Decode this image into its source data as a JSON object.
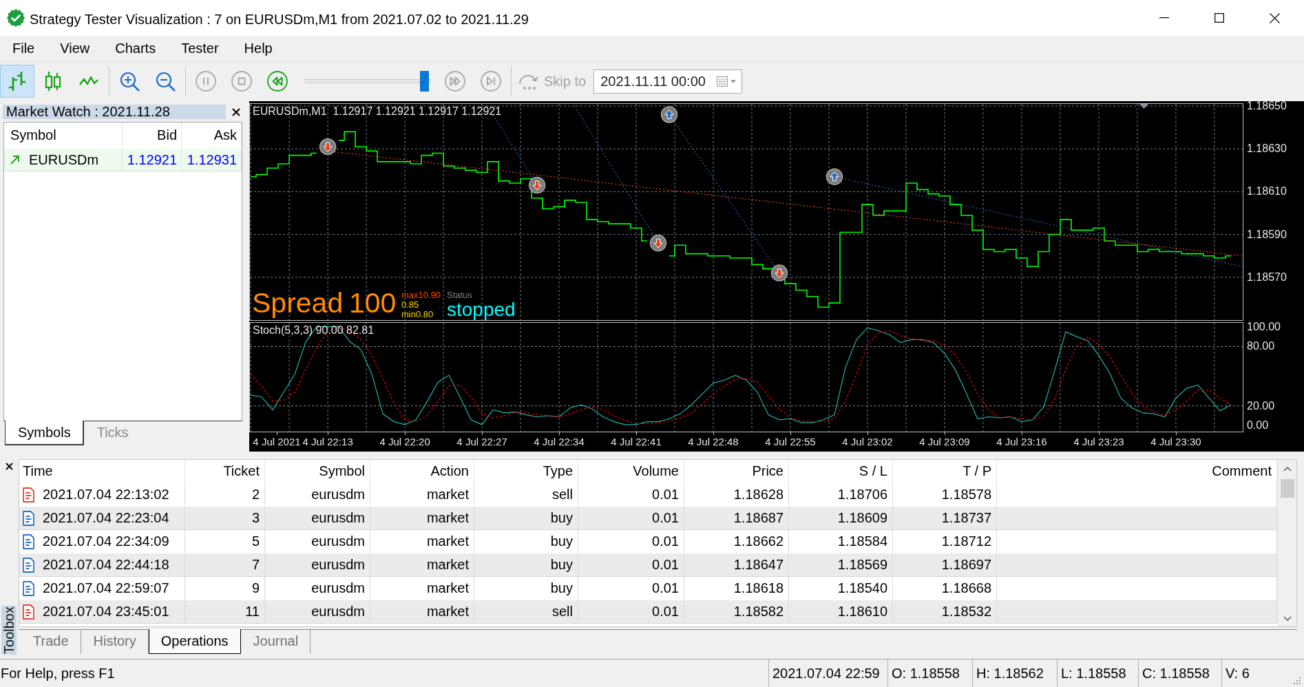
{
  "window": {
    "title": "Strategy Tester Visualization : 7 on EURUSDm,M1 from 2021.07.02 to 2021.11.29"
  },
  "menu": [
    "File",
    "View",
    "Charts",
    "Tester",
    "Help"
  ],
  "toolbar": {
    "chart_modes": [
      {
        "kind": "bars",
        "selected": true
      },
      {
        "kind": "candles",
        "selected": false
      },
      {
        "kind": "line",
        "selected": false
      }
    ],
    "playback": [
      {
        "kind": "pause",
        "disabled": true
      },
      {
        "kind": "stop",
        "disabled": true
      },
      {
        "kind": "rewind",
        "disabled": false
      }
    ],
    "speed_slider": {
      "level": 0.98
    },
    "stepping": [
      {
        "kind": "fast-forward",
        "disabled": true
      },
      {
        "kind": "step-end",
        "disabled": true
      }
    ],
    "skip_to": {
      "label": "Skip to",
      "disabled": true,
      "value": "2021.11.11 00:00"
    }
  },
  "market_watch": {
    "title": "Market Watch : 2021.11.28",
    "columns": [
      "Symbol",
      "Bid",
      "Ask"
    ],
    "rows": [
      {
        "rising": true,
        "symbol": "EURUSDm",
        "bid": "1.12921",
        "ask": "1.12931"
      }
    ],
    "tabs": [
      {
        "label": "Symbols",
        "selected": true
      },
      {
        "label": "Ticks",
        "selected": false
      }
    ]
  },
  "chart": {
    "chart_data": [
      {
        "type": "step",
        "title": "EURUSDm,M1  1.12917 1.12921 1.12917 1.12921",
        "tick_labels": "y",
        "grid": true,
        "xlim": [
          "2021-07-04T22:05:52",
          "2021-07-04T23:41:38"
        ],
        "ylim": [
          1.1855,
          1.18651
        ],
        "yticks": [
          {
            "value": 1.1865,
            "label": "1.18650"
          },
          {
            "value": 1.1863,
            "label": "1.18630"
          },
          {
            "value": 1.1861,
            "label": "1.18610"
          },
          {
            "value": 1.1859,
            "label": "1.18590"
          },
          {
            "value": 1.1857,
            "label": "1.18570"
          }
        ],
        "xticks": [
          "2021-07-04T22:08:22",
          "2021-07-04T22:13",
          "2021-07-04T22:20",
          "2021-07-04T22:27",
          "2021-07-04T22:34",
          "2021-07-04T22:41",
          "2021-07-04T22:48",
          "2021-07-04T22:55",
          "2021-07-04T23:02",
          "2021-07-04T23:09",
          "2021-07-04T23:16",
          "2021-07-04T23:23",
          "2021-07-04T23:30"
        ],
        "x": [
          "2021-07-04T22:06",
          "2021-07-04T22:07",
          "2021-07-04T22:08",
          "2021-07-04T22:09",
          "2021-07-04T22:10",
          "2021-07-04T22:11",
          "2021-07-04T22:12",
          "2021-07-04T22:13",
          "2021-07-04T22:14",
          "2021-07-04T22:15",
          "2021-07-04T22:16",
          "2021-07-04T22:17",
          "2021-07-04T22:18",
          "2021-07-04T22:19",
          "2021-07-04T22:20",
          "2021-07-04T22:21",
          "2021-07-04T22:22",
          "2021-07-04T22:23",
          "2021-07-04T22:24",
          "2021-07-04T22:25",
          "2021-07-04T22:26",
          "2021-07-04T22:27",
          "2021-07-04T22:28",
          "2021-07-04T22:29",
          "2021-07-04T22:30",
          "2021-07-04T22:31",
          "2021-07-04T22:32",
          "2021-07-04T22:33",
          "2021-07-04T22:34",
          "2021-07-04T22:35",
          "2021-07-04T22:36",
          "2021-07-04T22:37",
          "2021-07-04T22:38",
          "2021-07-04T22:39",
          "2021-07-04T22:40",
          "2021-07-04T22:41",
          "2021-07-04T22:42",
          "2021-07-04T22:43",
          "2021-07-04T22:44",
          "2021-07-04T22:45",
          "2021-07-04T22:46",
          "2021-07-04T22:47",
          "2021-07-04T22:48",
          "2021-07-04T22:49",
          "2021-07-04T22:50",
          "2021-07-04T22:51",
          "2021-07-04T22:52",
          "2021-07-04T22:53",
          "2021-07-04T22:54",
          "2021-07-04T22:55",
          "2021-07-04T22:56",
          "2021-07-04T22:57",
          "2021-07-04T22:58",
          "2021-07-04T22:59",
          "2021-07-04T23:00",
          "2021-07-04T23:01",
          "2021-07-04T23:02",
          "2021-07-04T23:03",
          "2021-07-04T23:04",
          "2021-07-04T23:05",
          "2021-07-04T23:06",
          "2021-07-04T23:07",
          "2021-07-04T23:08",
          "2021-07-04T23:09",
          "2021-07-04T23:10",
          "2021-07-04T23:11",
          "2021-07-04T23:12",
          "2021-07-04T23:13",
          "2021-07-04T23:14",
          "2021-07-04T23:15",
          "2021-07-04T23:16",
          "2021-07-04T23:17",
          "2021-07-04T23:18",
          "2021-07-04T23:19",
          "2021-07-04T23:20",
          "2021-07-04T23:21",
          "2021-07-04T23:22",
          "2021-07-04T23:23",
          "2021-07-04T23:24",
          "2021-07-04T23:25",
          "2021-07-04T23:26",
          "2021-07-04T23:27",
          "2021-07-04T23:28",
          "2021-07-04T23:29",
          "2021-07-04T23:30",
          "2021-07-04T23:31",
          "2021-07-04T23:32",
          "2021-07-04T23:33",
          "2021-07-04T23:34",
          "2021-07-04T23:35"
        ],
        "series": [
          {
            "color": "#00ff00",
            "values": [
              1.18617,
              1.18618,
              1.18621,
              1.18623,
              1.18627,
              1.18627,
              1.18628,
              null,
              1.18634,
              1.18638,
              1.18631,
              1.18629,
              1.18624,
              1.18624,
              1.18624,
              1.18623,
              1.18627,
              1.18628,
              1.18622,
              1.18621,
              1.1862,
              1.18619,
              1.18624,
              1.18615,
              1.18614,
              1.18616,
              1.18607,
              1.18602,
              1.18603,
              1.18606,
              1.18605,
              1.18597,
              1.18596,
              1.18595,
              1.18595,
              1.18593,
              1.18587,
              null,
              1.1858,
              1.18585,
              1.18581,
              1.18581,
              1.1858,
              1.1858,
              1.18579,
              1.18579,
              1.18576,
              1.18574,
              1.18572,
              1.18567,
              1.18564,
              1.18561,
              1.18556,
              1.18558,
              1.18591,
              1.18591,
              1.18604,
              1.18599,
              1.18601,
              1.18601,
              1.18614,
              1.18611,
              1.18609,
              1.18608,
              1.18604,
              1.18599,
              1.18592,
              1.18583,
              1.18582,
              1.18583,
              1.18579,
              1.18575,
              1.18582,
              1.1859,
              1.18597,
              1.18592,
              1.18592,
              1.18593,
              1.18587,
              1.18585,
              1.18585,
              1.18582,
              1.18583,
              1.18582,
              1.18582,
              1.18581,
              1.18581,
              1.1858,
              1.18579,
              1.1858
            ]
          },
          {
            "type": "line",
            "line_style": "dotted",
            "color": "#e8432a",
            "x": [
              "2021-07-04T22:13",
              "2021-07-04T23:36"
            ],
            "values": [
              1.18629,
              1.1858
            ]
          },
          {
            "type": "line",
            "line_style": "dotted",
            "color": "#2a64b0",
            "x": [
              "2021-07-04T22:27:30",
              "2021-07-04T22:32"
            ],
            "values": [
              1.1865,
              1.18613
            ]
          },
          {
            "type": "line",
            "line_style": "dotted",
            "color": "#2a64b0",
            "x": [
              "2021-07-04T22:35:25",
              "2021-07-04T22:43"
            ],
            "values": [
              1.1865,
              1.18586
            ]
          },
          {
            "type": "line",
            "line_style": "dotted",
            "color": "#2a64b0",
            "x": [
              "2021-07-04T22:44",
              "2021-07-04T22:54"
            ],
            "values": [
              1.18646,
              1.18572
            ]
          },
          {
            "type": "line",
            "line_style": "dotted",
            "color": "#2a64b0",
            "x": [
              "2021-07-04T22:59",
              "2021-07-04T23:36"
            ],
            "values": [
              1.18617,
              1.18575
            ]
          },
          {
            "type": "scatter",
            "color": "#e8401c",
            "x": [
              "2021-07-04T22:13",
              "2021-07-04T22:32",
              "2021-07-04T22:43",
              "2021-07-04T22:54"
            ],
            "values": [
              1.18631,
              1.18613,
              1.18586,
              1.18572
            ]
          },
          {
            "type": "scatter",
            "color": "#1f6fd0",
            "x": [
              "2021-07-04T22:44",
              "2021-07-04T22:59"
            ],
            "values": [
              1.18646,
              1.18617
            ]
          }
        ]
      },
      {
        "type": "line",
        "title": "Stoch(5,3,3) 90.00 82.81",
        "grid": true,
        "xlim": [
          "2021-07-04T22:05:52",
          "2021-07-04T23:41:38"
        ],
        "ylim": [
          -6,
          104
        ],
        "yticks": [
          {
            "value": 100,
            "label": "100.00"
          },
          {
            "value": 80,
            "label": "80.00"
          },
          {
            "value": 20,
            "label": "20.00"
          },
          {
            "value": 0,
            "label": "0.00"
          }
        ],
        "xticks": [
          {
            "value": "2021-07-04T22:08:22",
            "label": "4 Jul 2021"
          },
          {
            "value": "2021-07-04T22:13",
            "label": "4 Jul 22:13"
          },
          {
            "value": "2021-07-04T22:20",
            "label": "4 Jul 22:20"
          },
          {
            "value": "2021-07-04T22:27",
            "label": "4 Jul 22:27"
          },
          {
            "value": "2021-07-04T22:34",
            "label": "4 Jul 22:34"
          },
          {
            "value": "2021-07-04T22:41",
            "label": "4 Jul 22:41"
          },
          {
            "value": "2021-07-04T22:48",
            "label": "4 Jul 22:48"
          },
          {
            "value": "2021-07-04T22:55",
            "label": "4 Jul 22:55"
          },
          {
            "value": "2021-07-04T23:02",
            "label": "4 Jul 23:02"
          },
          {
            "value": "2021-07-04T23:09",
            "label": "4 Jul 23:09"
          },
          {
            "value": "2021-07-04T23:16",
            "label": "4 Jul 23:16"
          },
          {
            "value": "2021-07-04T23:23",
            "label": "4 Jul 23:23"
          },
          {
            "value": "2021-07-04T23:30",
            "label": "4 Jul 23:30"
          }
        ],
        "x": [
          "2021-07-04T22:06",
          "2021-07-04T22:07",
          "2021-07-04T22:08",
          "2021-07-04T22:09",
          "2021-07-04T22:10",
          "2021-07-04T22:11",
          "2021-07-04T22:12",
          "2021-07-04T22:13",
          "2021-07-04T22:14",
          "2021-07-04T22:15",
          "2021-07-04T22:16",
          "2021-07-04T22:17",
          "2021-07-04T22:18",
          "2021-07-04T22:19",
          "2021-07-04T22:20",
          "2021-07-04T22:21",
          "2021-07-04T22:22",
          "2021-07-04T22:23",
          "2021-07-04T22:24",
          "2021-07-04T22:25",
          "2021-07-04T22:26",
          "2021-07-04T22:27",
          "2021-07-04T22:28",
          "2021-07-04T22:29",
          "2021-07-04T22:30",
          "2021-07-04T22:31",
          "2021-07-04T22:32",
          "2021-07-04T22:33",
          "2021-07-04T22:34",
          "2021-07-04T22:35",
          "2021-07-04T22:36",
          "2021-07-04T22:37",
          "2021-07-04T22:38",
          "2021-07-04T22:39",
          "2021-07-04T22:40",
          "2021-07-04T22:41",
          "2021-07-04T22:42",
          "2021-07-04T22:43",
          "2021-07-04T22:44",
          "2021-07-04T22:45",
          "2021-07-04T22:46",
          "2021-07-04T22:47",
          "2021-07-04T22:48",
          "2021-07-04T22:49",
          "2021-07-04T22:50",
          "2021-07-04T22:51",
          "2021-07-04T22:52",
          "2021-07-04T22:53",
          "2021-07-04T22:54",
          "2021-07-04T22:55",
          "2021-07-04T22:56",
          "2021-07-04T22:57",
          "2021-07-04T22:58",
          "2021-07-04T22:59",
          "2021-07-04T23:00",
          "2021-07-04T23:01",
          "2021-07-04T23:02",
          "2021-07-04T23:03",
          "2021-07-04T23:04",
          "2021-07-04T23:05",
          "2021-07-04T23:06",
          "2021-07-04T23:07",
          "2021-07-04T23:08",
          "2021-07-04T23:09",
          "2021-07-04T23:10",
          "2021-07-04T23:11",
          "2021-07-04T23:12",
          "2021-07-04T23:13",
          "2021-07-04T23:14",
          "2021-07-04T23:15",
          "2021-07-04T23:16",
          "2021-07-04T23:17",
          "2021-07-04T23:18",
          "2021-07-04T23:19",
          "2021-07-04T23:20",
          "2021-07-04T23:21",
          "2021-07-04T23:22",
          "2021-07-04T23:23",
          "2021-07-04T23:24",
          "2021-07-04T23:25",
          "2021-07-04T23:26",
          "2021-07-04T23:27",
          "2021-07-04T23:28",
          "2021-07-04T23:29",
          "2021-07-04T23:30",
          "2021-07-04T23:31",
          "2021-07-04T23:32",
          "2021-07-04T23:33",
          "2021-07-04T23:34",
          "2021-07-04T23:35"
        ],
        "series": [
          {
            "color": "#20b2aa",
            "values": [
              31,
              29,
              16,
              34,
              52,
              85,
              100,
              100,
              100,
              85,
              77,
              52,
              12,
              4,
              1,
              6,
              24,
              44,
              51,
              29,
              6,
              1,
              16,
              13,
              14,
              11,
              9,
              10,
              9,
              18,
              21,
              17,
              9,
              4,
              1,
              1,
              4,
              4,
              7,
              12,
              21,
              32,
              43,
              46,
              51,
              46,
              34,
              11,
              6,
              7,
              3,
              3,
              6,
              11,
              59,
              87,
              99,
              96,
              92,
              84,
              87,
              87,
              84,
              73,
              56,
              32,
              7,
              9,
              8,
              9,
              4,
              6,
              19,
              56,
              95,
              90,
              86,
              71,
              53,
              28,
              18,
              13,
              12,
              9,
              28,
              38,
              41,
              28,
              15,
              21
            ]
          },
          {
            "color": "#ff0000",
            "line_style": "dotted",
            "values": [
              52,
              40,
              25,
              26,
              34,
              57,
              79,
              95,
              100,
              95,
              87,
              71,
              47,
              23,
              6,
              4,
              10,
              25,
              40,
              41,
              29,
              12,
              8,
              10,
              14,
              13,
              11,
              10,
              9,
              12,
              16,
              19,
              16,
              10,
              5,
              2,
              2,
              3,
              5,
              8,
              13,
              22,
              32,
              40,
              47,
              48,
              44,
              30,
              17,
              8,
              5,
              4,
              4,
              7,
              25,
              52,
              82,
              94,
              96,
              91,
              88,
              86,
              86,
              81,
              71,
              54,
              32,
              16,
              8,
              9,
              7,
              6,
              10,
              27,
              57,
              80,
              90,
              82,
              70,
              51,
              33,
              20,
              14,
              11,
              16,
              25,
              36,
              36,
              28,
              21
            ]
          }
        ]
      }
    ],
    "labels": [
      {
        "text": "Spread",
        "kind": "large",
        "color": "#ff8c00"
      },
      {
        "text": "100",
        "kind": "large",
        "color": "#ff8c00"
      },
      {
        "text": "max10.90",
        "kind": "small",
        "color": "#ff4500"
      },
      {
        "text": "0.85",
        "kind": "small",
        "color": "#ffd700"
      },
      {
        "text": "min0.80",
        "kind": "small",
        "color": "#ffd700"
      },
      {
        "text": "Status",
        "kind": "small",
        "color": "#808080"
      },
      {
        "text": "stopped",
        "kind": "medium",
        "color": "#00ffff"
      }
    ]
  },
  "toolbox": {
    "title": "Toolbox",
    "columns": [
      "Time",
      "Ticket",
      "Symbol",
      "Action",
      "Type",
      "Volume",
      "Price",
      "S / L",
      "T / P",
      "Comment"
    ],
    "rows": [
      {
        "kind": "sell",
        "cells": [
          "2021.07.04 22:13:02",
          "2",
          "eurusdm",
          "market",
          "sell",
          "0.01",
          "1.18628",
          "1.18706",
          "1.18578"
        ]
      },
      {
        "kind": "buy",
        "cells": [
          "2021.07.04 22:23:04",
          "3",
          "eurusdm",
          "market",
          "buy",
          "0.01",
          "1.18687",
          "1.18609",
          "1.18737"
        ]
      },
      {
        "kind": "buy",
        "cells": [
          "2021.07.04 22:34:09",
          "5",
          "eurusdm",
          "market",
          "buy",
          "0.01",
          "1.18662",
          "1.18584",
          "1.18712"
        ]
      },
      {
        "kind": "buy",
        "cells": [
          "2021.07.04 22:44:18",
          "7",
          "eurusdm",
          "market",
          "buy",
          "0.01",
          "1.18647",
          "1.18569",
          "1.18697"
        ]
      },
      {
        "kind": "buy",
        "cells": [
          "2021.07.04 22:59:07",
          "9",
          "eurusdm",
          "market",
          "buy",
          "0.01",
          "1.18618",
          "1.18540",
          "1.18668"
        ]
      },
      {
        "kind": "sell",
        "cells": [
          "2021.07.04 23:45:01",
          "11",
          "eurusdm",
          "market",
          "sell",
          "0.01",
          "1.18582",
          "1.18610",
          "1.18532"
        ]
      }
    ],
    "tabs": [
      {
        "label": "Trade",
        "selected": false
      },
      {
        "label": "History",
        "selected": false
      },
      {
        "label": "Operations",
        "selected": true
      },
      {
        "label": "Journal",
        "selected": false
      }
    ]
  },
  "status_bar": {
    "help": "For Help, press F1",
    "fields": [
      "2021.07.04 22:59",
      "O: 1.18558",
      "H: 1.18562",
      "L: 1.18558",
      "C: 1.18558",
      "V: 6"
    ]
  }
}
